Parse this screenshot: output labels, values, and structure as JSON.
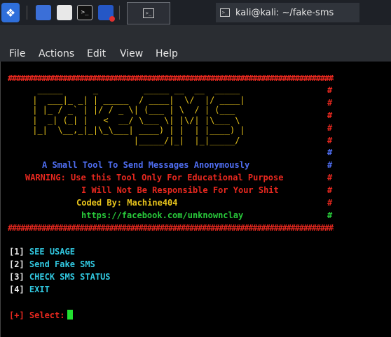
{
  "taskbar": {
    "window_title": "kali@kali: ~/fake-sms",
    "mini_term_glyph": ">_"
  },
  "menu": [
    "File",
    "Actions",
    "Edit",
    "View",
    "Help"
  ],
  "terminal": {
    "hash_line": "##################################################################################",
    "right_hash": "#",
    "ascii_art": "  _____      _         _____ __  __  _____\n |  ___|_ _| | _____  / ____|  \\/  |/ ____|\n | |_ / _` | |/ / _ \\| (___ | \\  / | (___\n |  _| (_| |   <  __/ \\___ \\| |\\/| |\\___ \\\n |_|  \\__,_|_|\\_\\___| ____) | |  | |____) |\n                     |_____/|_|  |_|_____/",
    "tagline": "A Small Tool To Send Messages Anonymously",
    "warning": "WARNING: Use this Tool Only For Educational Purpose",
    "disclaimer": "I Will Not Be Responsible For Your Shit",
    "coded_by": "Coded By: Machine404",
    "link": "https://facebook.com/unknownclay",
    "options": [
      {
        "num": "[1]",
        "label": "SEE USAGE"
      },
      {
        "num": "[2]",
        "label": "Send Fake SMS"
      },
      {
        "num": "[3]",
        "label": "CHECK SMS STATUS"
      },
      {
        "num": "[4]",
        "label": "EXIT"
      }
    ],
    "prompt": "[+] Select:"
  }
}
